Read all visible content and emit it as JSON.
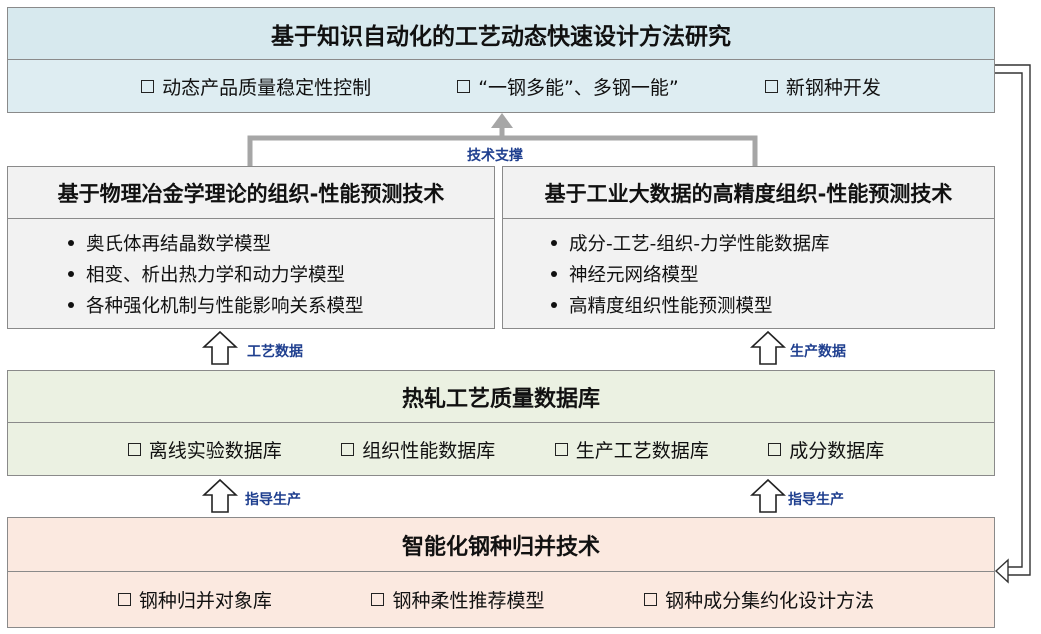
{
  "top": {
    "title": "基于知识自动化的工艺动态快速设计方法研究",
    "items": [
      "动态产品质量稳定性控制",
      "“一钢多能”、多钢一能”",
      "新钢种开发"
    ]
  },
  "support_label": "技术支撑",
  "left_panel": {
    "title": "基于物理冶金学理论的组织-性能预测技术",
    "bullets": [
      "奥氏体再结晶数学模型",
      "相变、析出热力学和动力学模型",
      "各种强化机制与性能影响关系模型"
    ]
  },
  "right_panel": {
    "title": "基于工业大数据的高精度组织-性能预测技术",
    "bullets": [
      "成分-工艺-组织-力学性能数据库",
      "神经元网络模型",
      "高精度组织性能预测模型"
    ]
  },
  "arrow_labels": {
    "process_data": "工艺数据",
    "production_data": "生产数据",
    "guide_left": "指导生产",
    "guide_right": "指导生产"
  },
  "middle": {
    "title": "热轧工艺质量数据库",
    "items": [
      "离线实验数据库",
      "组织性能数据库",
      "生产工艺数据库",
      "成分数据库"
    ]
  },
  "bottom": {
    "title": "智能化钢种归并技术",
    "items": [
      "钢种归并对象库",
      "钢种柔性推荐模型",
      "钢种成分集约化设计方法"
    ]
  },
  "colors": {
    "top_header": "#d7e9ee",
    "top_body": "#deedf2",
    "panel_header": "#f2f2f2",
    "panel_body": "#f2f2f2",
    "middle": "#ebf1e2",
    "bottom": "#fbe9e0",
    "label_blue": "#1f3f8f",
    "connector_gray": "#a6a6a6"
  }
}
